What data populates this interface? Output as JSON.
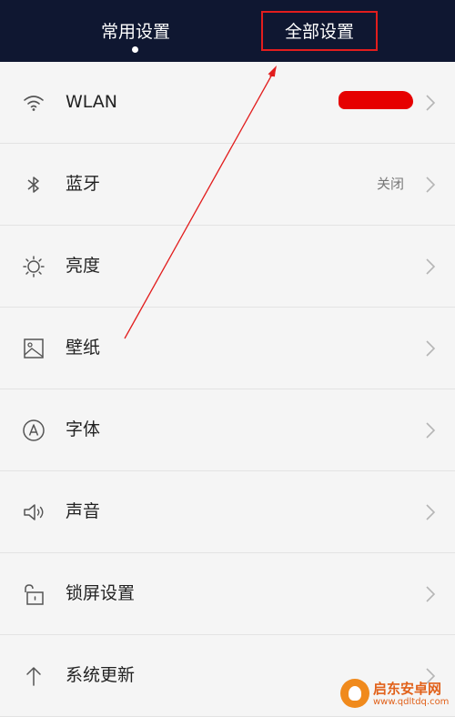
{
  "header": {
    "tabs": [
      {
        "label": "常用设置",
        "active": true
      },
      {
        "label": "全部设置",
        "active": false
      }
    ]
  },
  "settings": [
    {
      "icon": "wifi-icon",
      "label": "WLAN",
      "value": "",
      "value_redacted": true
    },
    {
      "icon": "bluetooth-icon",
      "label": "蓝牙",
      "value": "关闭"
    },
    {
      "icon": "brightness-icon",
      "label": "亮度",
      "value": ""
    },
    {
      "icon": "wallpaper-icon",
      "label": "壁纸",
      "value": ""
    },
    {
      "icon": "font-icon",
      "label": "字体",
      "value": ""
    },
    {
      "icon": "sound-icon",
      "label": "声音",
      "value": ""
    },
    {
      "icon": "lock-icon",
      "label": "锁屏设置",
      "value": ""
    },
    {
      "icon": "arrow-up-icon",
      "label": "系统更新",
      "value": ""
    }
  ],
  "watermark": {
    "title": "启东安卓网",
    "url": "www.qdltdq.com"
  },
  "colors": {
    "header_bg": "#0f1731",
    "annotation_red": "#e21d1d",
    "list_bg": "#f5f5f5",
    "watermark_orange": "#e1611a"
  }
}
